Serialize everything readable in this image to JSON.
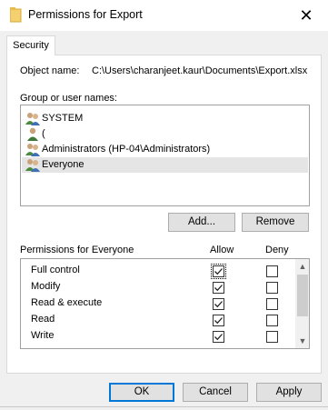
{
  "window": {
    "title": "Permissions for Export",
    "close_glyph": "✕",
    "icon": "folder-icon"
  },
  "tabs": [
    {
      "label": "Security"
    }
  ],
  "object": {
    "label": "Object name:",
    "value": "C:\\Users\\charanjeet.kaur\\Documents\\Export.xlsx"
  },
  "groups": {
    "label": "Group or user names:",
    "items": [
      {
        "name": "SYSTEM",
        "icon": "users-group-icon"
      },
      {
        "name": "(",
        "icon": "user-icon"
      },
      {
        "name": "Administrators (HP-04\\Administrators)",
        "icon": "users-group-icon"
      },
      {
        "name": "Everyone",
        "icon": "users-group-icon",
        "selected": true
      }
    ]
  },
  "buttons": {
    "add": "Add...",
    "remove": "Remove",
    "ok": "OK",
    "cancel": "Cancel",
    "apply": "Apply"
  },
  "permissions": {
    "label": "Permissions for Everyone",
    "allow_header": "Allow",
    "deny_header": "Deny",
    "rows": [
      {
        "name": "Full control",
        "allow": true,
        "deny": false
      },
      {
        "name": "Modify",
        "allow": true,
        "deny": false
      },
      {
        "name": "Read & execute",
        "allow": true,
        "deny": false
      },
      {
        "name": "Read",
        "allow": true,
        "deny": false
      },
      {
        "name": "Write",
        "allow": true,
        "deny": false
      }
    ]
  },
  "colors": {
    "accent": "#0078d7",
    "selection": "#e5e5e5",
    "dialog_bg": "#f0f0f0"
  }
}
